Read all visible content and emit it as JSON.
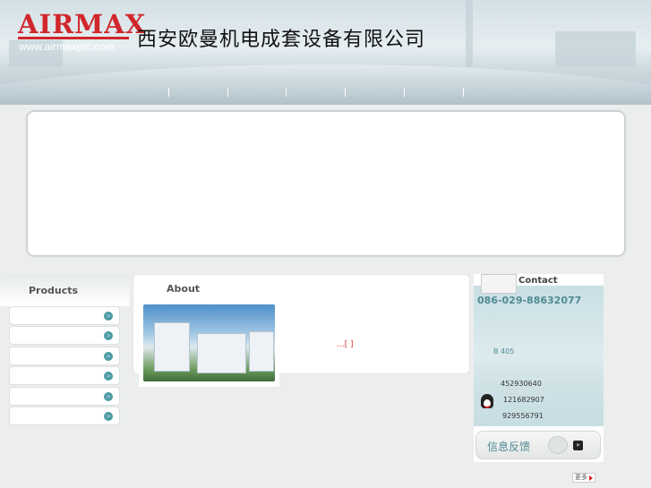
{
  "header": {
    "logo": "AIRMAX",
    "url": "www.airmaxptc.com",
    "company": "西安欧曼机电成套设备有限公司"
  },
  "products": {
    "title": "Products",
    "item_count": 6
  },
  "about": {
    "title": "About",
    "more": "...[  ]"
  },
  "contact": {
    "title": "Contact",
    "phone": "086-029-88632077",
    "address": "B 405",
    "qq": [
      "452930640",
      "121682907",
      "929556791"
    ],
    "feedback": "信息反馈"
  },
  "more_button": "更多"
}
